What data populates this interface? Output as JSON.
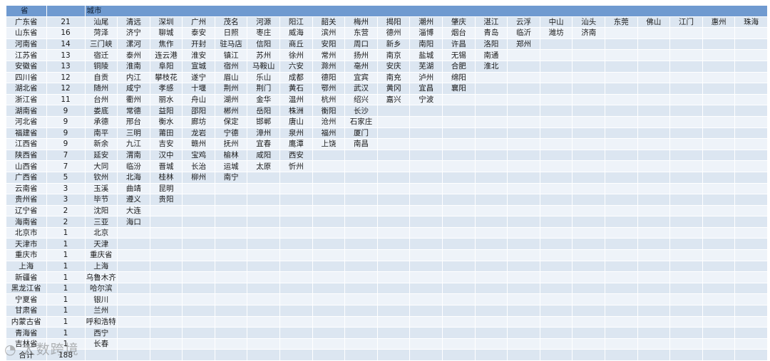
{
  "header": {
    "province": "省",
    "count": "",
    "cities": "城市"
  },
  "rows": [
    {
      "province": "广东省",
      "count": "21",
      "cities": [
        "汕尾",
        "清远",
        "深圳",
        "广州",
        "茂名",
        "河源",
        "阳江",
        "韶关",
        "梅州",
        "揭阳",
        "潮州",
        "肇庆",
        "湛江",
        "云浮",
        "中山",
        "汕头",
        "东莞",
        "佛山",
        "江门",
        "惠州",
        "珠海"
      ]
    },
    {
      "province": "山东省",
      "count": "16",
      "cities": [
        "菏泽",
        "济宁",
        "聊城",
        "泰安",
        "日照",
        "枣庄",
        "威海",
        "滨州",
        "东营",
        "德州",
        "淄博",
        "烟台",
        "青岛",
        "临沂",
        "潍坊",
        "济南"
      ]
    },
    {
      "province": "河南省",
      "count": "14",
      "cities": [
        "三门峡",
        "漯河",
        "焦作",
        "开封",
        "驻马店",
        "信阳",
        "商丘",
        "安阳",
        "周口",
        "新乡",
        "南阳",
        "许昌",
        "洛阳",
        "郑州"
      ]
    },
    {
      "province": "江苏省",
      "count": "13",
      "cities": [
        "宿迁",
        "泰州",
        "连云港",
        "淮安",
        "镇江",
        "苏州",
        "徐州",
        "常州",
        "扬州",
        "南京",
        "盐城",
        "无锡",
        "南通"
      ]
    },
    {
      "province": "安徽省",
      "count": "13",
      "cities": [
        "铜陵",
        "淮南",
        "阜阳",
        "宣城",
        "宿州",
        "马鞍山",
        "六安",
        "滁州",
        "亳州",
        "安庆",
        "芜湖",
        "合肥",
        "淮北"
      ]
    },
    {
      "province": "四川省",
      "count": "12",
      "cities": [
        "自贡",
        "内江",
        "攀枝花",
        "遂宁",
        "眉山",
        "乐山",
        "成都",
        "德阳",
        "宜宾",
        "南充",
        "泸州",
        "绵阳"
      ]
    },
    {
      "province": "湖北省",
      "count": "12",
      "cities": [
        "随州",
        "咸宁",
        "孝感",
        "十堰",
        "荆州",
        "荆门",
        "黄石",
        "鄂州",
        "武汉",
        "黄冈",
        "宜昌",
        "襄阳"
      ]
    },
    {
      "province": "浙江省",
      "count": "11",
      "cities": [
        "台州",
        "衢州",
        "丽水",
        "舟山",
        "湖州",
        "金华",
        "温州",
        "杭州",
        "绍兴",
        "嘉兴",
        "宁波"
      ]
    },
    {
      "province": "湖南省",
      "count": "9",
      "cities": [
        "娄底",
        "常德",
        "益阳",
        "邵阳",
        "郴州",
        "岳阳",
        "株洲",
        "衡阳",
        "长沙"
      ]
    },
    {
      "province": "河北省",
      "count": "9",
      "cities": [
        "承德",
        "邢台",
        "衡水",
        "廊坊",
        "保定",
        "邯郸",
        "唐山",
        "沧州",
        "石家庄"
      ]
    },
    {
      "province": "福建省",
      "count": "9",
      "cities": [
        "南平",
        "三明",
        "莆田",
        "龙岩",
        "宁德",
        "漳州",
        "泉州",
        "福州",
        "厦门"
      ]
    },
    {
      "province": "江西省",
      "count": "9",
      "cities": [
        "新余",
        "九江",
        "吉安",
        "赣州",
        "抚州",
        "宜春",
        "鹰潭",
        "上饶",
        "南昌"
      ]
    },
    {
      "province": "陕西省",
      "count": "7",
      "cities": [
        "延安",
        "渭南",
        "汉中",
        "宝鸡",
        "榆林",
        "咸阳",
        "西安"
      ]
    },
    {
      "province": "山西省",
      "count": "7",
      "cities": [
        "大同",
        "临汾",
        "晋城",
        "长治",
        "运城",
        "太原",
        "忻州"
      ]
    },
    {
      "province": "广西省",
      "count": "5",
      "cities": [
        "钦州",
        "北海",
        "桂林",
        "柳州",
        "南宁"
      ]
    },
    {
      "province": "云南省",
      "count": "3",
      "cities": [
        "玉溪",
        "曲靖",
        "昆明"
      ]
    },
    {
      "province": "贵州省",
      "count": "3",
      "cities": [
        "毕节",
        "遵义",
        "贵阳"
      ]
    },
    {
      "province": "辽宁省",
      "count": "2",
      "cities": [
        "沈阳",
        "大连"
      ]
    },
    {
      "province": "海南省",
      "count": "2",
      "cities": [
        "三亚",
        "海口"
      ]
    },
    {
      "province": "北京市",
      "count": "1",
      "cities": [
        "北京"
      ]
    },
    {
      "province": "天津市",
      "count": "1",
      "cities": [
        "天津"
      ]
    },
    {
      "province": "重庆市",
      "count": "1",
      "cities": [
        "重庆省"
      ]
    },
    {
      "province": "上海",
      "count": "1",
      "cities": [
        "上海"
      ]
    },
    {
      "province": "新疆省",
      "count": "1",
      "cities": [
        "乌鲁木齐"
      ]
    },
    {
      "province": "黑龙江省",
      "count": "1",
      "cities": [
        "哈尔滨"
      ]
    },
    {
      "province": "宁夏省",
      "count": "1",
      "cities": [
        "银川"
      ]
    },
    {
      "province": "甘肃省",
      "count": "1",
      "cities": [
        "兰州"
      ]
    },
    {
      "province": "内蒙古省",
      "count": "1",
      "cities": [
        "呼和浩特"
      ]
    },
    {
      "province": "青海省",
      "count": "1",
      "cities": [
        "西宁"
      ]
    },
    {
      "province": "吉林省",
      "count": "1",
      "cities": [
        "长春"
      ]
    }
  ],
  "total": {
    "label": "合计",
    "count": "188"
  },
  "watermark": "大数跨境"
}
